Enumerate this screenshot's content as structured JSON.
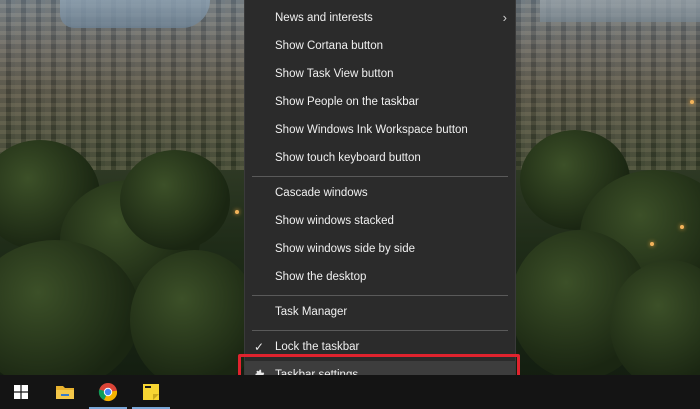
{
  "context_menu": {
    "items": [
      {
        "label": "News and interests",
        "has_submenu": true
      },
      {
        "label": "Show Cortana button"
      },
      {
        "label": "Show Task View button"
      },
      {
        "label": "Show People on the taskbar"
      },
      {
        "label": "Show Windows Ink Workspace button"
      },
      {
        "label": "Show touch keyboard button"
      },
      {
        "label": "Cascade windows"
      },
      {
        "label": "Show windows stacked"
      },
      {
        "label": "Show windows side by side"
      },
      {
        "label": "Show the desktop"
      },
      {
        "label": "Task Manager"
      },
      {
        "label": "Lock the taskbar",
        "checked": true
      },
      {
        "label": "Taskbar settings",
        "icon": "gear-icon",
        "highlighted": true
      }
    ],
    "background": "#2b2b2b",
    "text_color": "#f0f0f0"
  },
  "highlight_color": "#e0232e",
  "taskbar": {
    "background": "#141414",
    "icons": [
      "windows-start-icon",
      "file-explorer-icon",
      "chrome-icon",
      "sticky-notes-icon"
    ],
    "active_indicator_color": "#7aa7d8"
  }
}
